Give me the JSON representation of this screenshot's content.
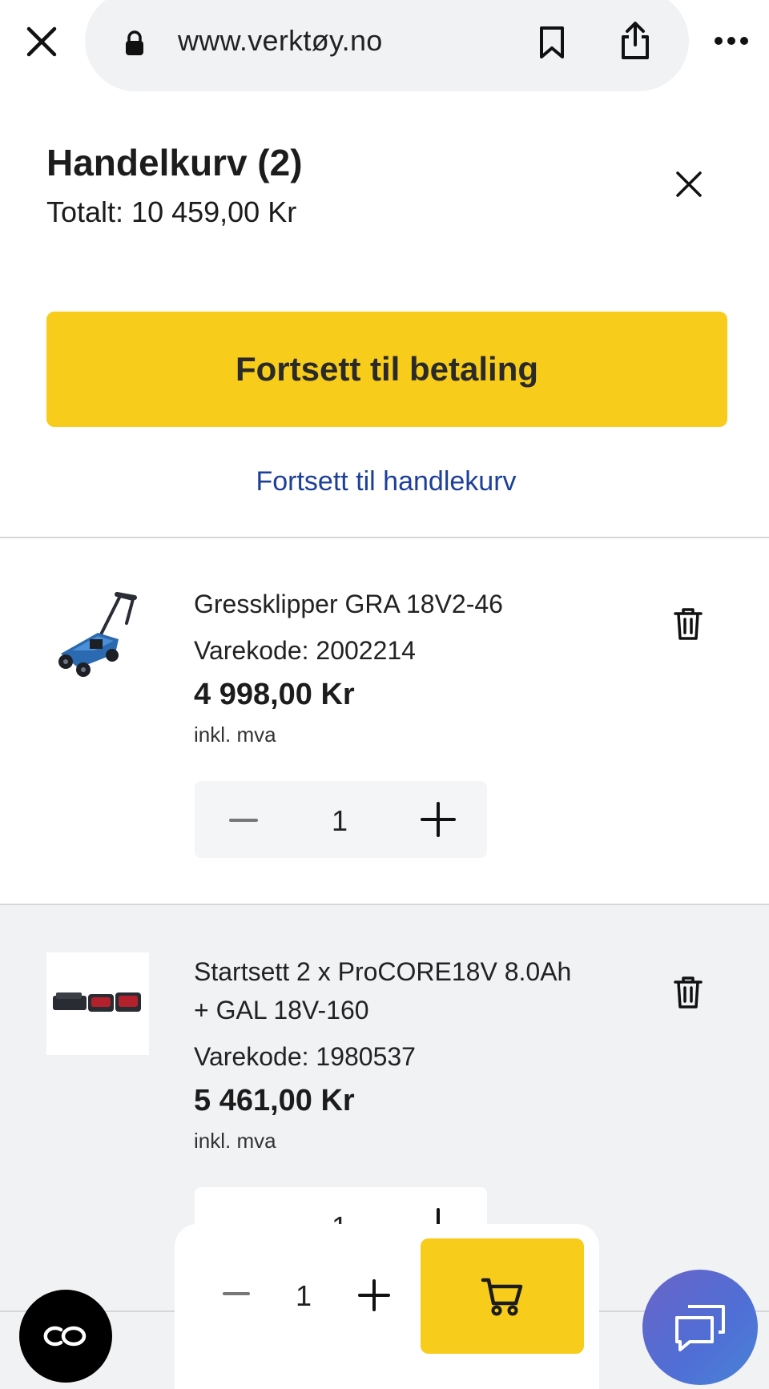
{
  "browser": {
    "url": "www.verktøy.no"
  },
  "cart": {
    "title": "Handelkurv (2)",
    "total": "Totalt: 10 459,00 Kr",
    "checkout_label": "Fortsett til betaling",
    "continue_cart_label": "Fortsett til handlekurv"
  },
  "items": [
    {
      "name": "Gressklipper GRA 18V2-46",
      "code": "Varekode: 2002214",
      "price": "4 998,00 Kr",
      "vat": "inkl. mva",
      "quantity": "1",
      "image_icon": "lawn-mower-image"
    },
    {
      "name_line1": "Startsett 2 x ProCORE18V 8.0Ah",
      "name_line2": "+ GAL 18V-160",
      "code": "Varekode: 1980537",
      "price": "5 461,00 Kr",
      "vat": "inkl. mva",
      "quantity": "1",
      "image_icon": "battery-starter-kit-image"
    }
  ],
  "sticky": {
    "quantity": "1",
    "cart_icon": "shopping-cart-icon"
  },
  "colors": {
    "accent": "#f7cc1a",
    "link": "#1d3f9a",
    "item_bg": "#f1f2f4",
    "chat_gradient_start": "#6a64c7",
    "chat_gradient_end": "#4a84d8"
  }
}
